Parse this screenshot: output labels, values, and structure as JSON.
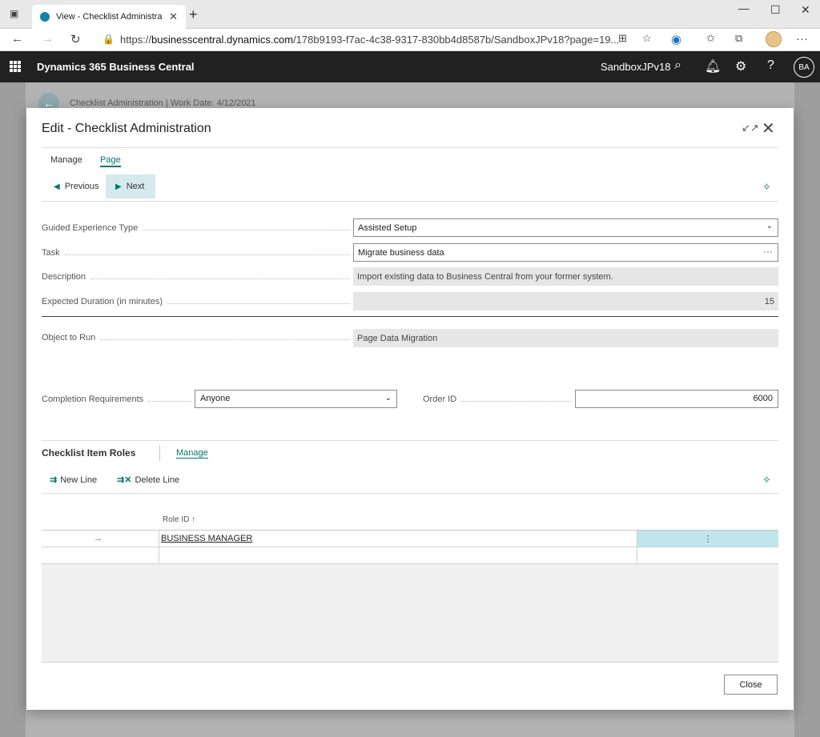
{
  "browser": {
    "tab_title": "View - Checklist Administration -",
    "tab_close": "✕",
    "new_tab": "+",
    "url_prefix": "https://",
    "url_host": "businesscentral.dynamics.com",
    "url_path": "/178b9193-f7ac-4c38-9317-830bb4d8587b/SandboxJPv18?page=19..."
  },
  "appbar": {
    "app_name": "Dynamics 365 Business Central",
    "environment": "SandboxJPv18",
    "user_initials": "BA"
  },
  "background_page": {
    "title": "Checklist Administration | Work Date: 4/12/2021"
  },
  "dialog": {
    "title": "Edit - Checklist Administration",
    "menu": {
      "manage": "Manage",
      "page": "Page"
    },
    "actions": {
      "previous": "Previous",
      "next": "Next"
    },
    "fields": {
      "guided_type_label": "Guided Experience Type",
      "guided_type_value": "Assisted Setup",
      "task_label": "Task",
      "task_value": "Migrate business data",
      "task_ellipsis": "···",
      "description_label": "Description",
      "description_value": "Import existing data to Business Central from your former system.",
      "duration_label": "Expected Duration (in minutes)",
      "duration_value": "15",
      "object_label": "Object to Run",
      "object_value": "Page Data Migration",
      "completion_label": "Completion Requirements",
      "completion_value": "Anyone",
      "order_label": "Order ID",
      "order_value": "6000"
    },
    "part": {
      "title": "Checklist Item Roles",
      "manage": "Manage",
      "new_line": "New Line",
      "delete_line": "Delete Line",
      "col_role_id": "Role ID ↑",
      "rows": [
        {
          "indicator": "→",
          "role_id": "BUSINESS MANAGER",
          "menu": "⋮"
        }
      ]
    },
    "close": "Close"
  }
}
